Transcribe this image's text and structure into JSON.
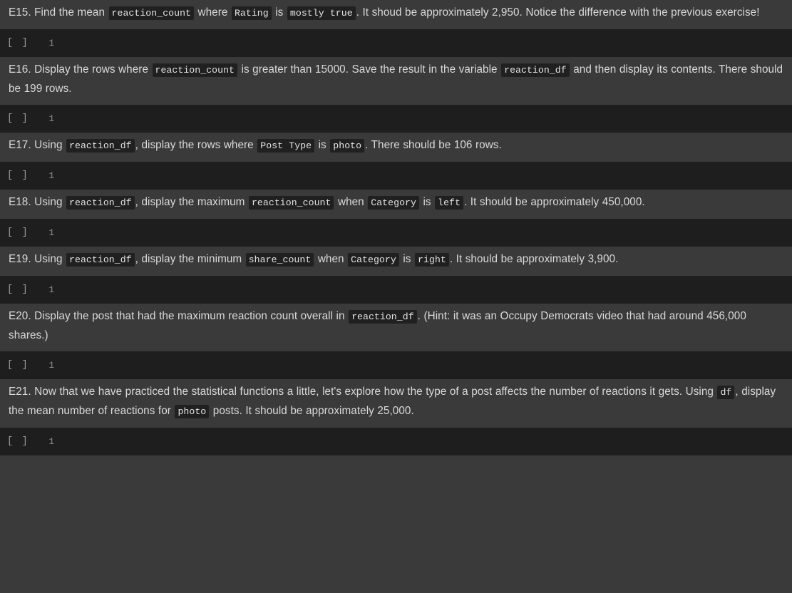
{
  "theme": {
    "markdown_bg": "#3a3a3a",
    "code_bg": "#1e1e1e",
    "text_color": "#d9d9d9",
    "chip_bg": "#202020",
    "chip_text": "#e3e3e3",
    "prompt_color": "#9a9a9a"
  },
  "cells": [
    {
      "type": "markdown",
      "id": "E15",
      "segments": [
        {
          "t": "text",
          "v": "E15. Find the mean "
        },
        {
          "t": "code",
          "v": "reaction_count"
        },
        {
          "t": "text",
          "v": " where "
        },
        {
          "t": "code",
          "v": "Rating"
        },
        {
          "t": "text",
          "v": " is "
        },
        {
          "t": "code",
          "v": "mostly true"
        },
        {
          "t": "text",
          "v": ". It shoud be approximately 2,950. Notice the difference with the previous exercise!"
        }
      ]
    },
    {
      "type": "code",
      "prompt": "[ ]",
      "line_number": "1",
      "source": ""
    },
    {
      "type": "markdown",
      "id": "E16",
      "segments": [
        {
          "t": "text",
          "v": "E16. Display the rows where "
        },
        {
          "t": "code",
          "v": "reaction_count"
        },
        {
          "t": "text",
          "v": " is greater than 15000. Save the result in the variable "
        },
        {
          "t": "code",
          "v": "reaction_df"
        },
        {
          "t": "text",
          "v": " and then display its contents. There should be 199 rows."
        }
      ]
    },
    {
      "type": "code",
      "prompt": "[ ]",
      "line_number": "1",
      "source": ""
    },
    {
      "type": "markdown",
      "id": "E17",
      "segments": [
        {
          "t": "text",
          "v": "E17. Using "
        },
        {
          "t": "code",
          "v": "reaction_df"
        },
        {
          "t": "text",
          "v": ", display the rows where "
        },
        {
          "t": "code",
          "v": "Post Type"
        },
        {
          "t": "text",
          "v": " is "
        },
        {
          "t": "code",
          "v": "photo"
        },
        {
          "t": "text",
          "v": ". There should be 106 rows."
        }
      ]
    },
    {
      "type": "code",
      "prompt": "[ ]",
      "line_number": "1",
      "source": ""
    },
    {
      "type": "markdown",
      "id": "E18",
      "segments": [
        {
          "t": "text",
          "v": "E18. Using "
        },
        {
          "t": "code",
          "v": "reaction_df"
        },
        {
          "t": "text",
          "v": ", display the maximum "
        },
        {
          "t": "code",
          "v": "reaction_count"
        },
        {
          "t": "text",
          "v": " when "
        },
        {
          "t": "code",
          "v": "Category"
        },
        {
          "t": "text",
          "v": " is "
        },
        {
          "t": "code",
          "v": "left"
        },
        {
          "t": "text",
          "v": ". It should be approximately 450,000."
        }
      ]
    },
    {
      "type": "code",
      "prompt": "[ ]",
      "line_number": "1",
      "source": ""
    },
    {
      "type": "markdown",
      "id": "E19",
      "segments": [
        {
          "t": "text",
          "v": "E19. Using "
        },
        {
          "t": "code",
          "v": "reaction_df"
        },
        {
          "t": "text",
          "v": ", display the minimum "
        },
        {
          "t": "code",
          "v": "share_count"
        },
        {
          "t": "text",
          "v": " when "
        },
        {
          "t": "code",
          "v": "Category"
        },
        {
          "t": "text",
          "v": " is "
        },
        {
          "t": "code",
          "v": "right"
        },
        {
          "t": "text",
          "v": ". It should be approximately 3,900."
        }
      ]
    },
    {
      "type": "code",
      "prompt": "[ ]",
      "line_number": "1",
      "source": ""
    },
    {
      "type": "markdown",
      "id": "E20",
      "segments": [
        {
          "t": "text",
          "v": "E20. Display the post that had the maximum reaction count overall in "
        },
        {
          "t": "code",
          "v": "reaction_df"
        },
        {
          "t": "text",
          "v": ". (Hint: it was an Occupy Democrats video that had around 456,000 shares.)"
        }
      ]
    },
    {
      "type": "code",
      "prompt": "[ ]",
      "line_number": "1",
      "source": ""
    },
    {
      "type": "markdown",
      "id": "E21",
      "segments": [
        {
          "t": "text",
          "v": "E21. Now that we have practiced the statistical functions a little, let's explore how the type of a post affects the number of reactions it gets. Using "
        },
        {
          "t": "code",
          "v": "df"
        },
        {
          "t": "text",
          "v": ", display the mean number of reactions for "
        },
        {
          "t": "code",
          "v": "photo"
        },
        {
          "t": "text",
          "v": " posts. It should be approximately 25,000."
        }
      ]
    },
    {
      "type": "code",
      "prompt": "[ ]",
      "line_number": "1",
      "source": ""
    }
  ]
}
